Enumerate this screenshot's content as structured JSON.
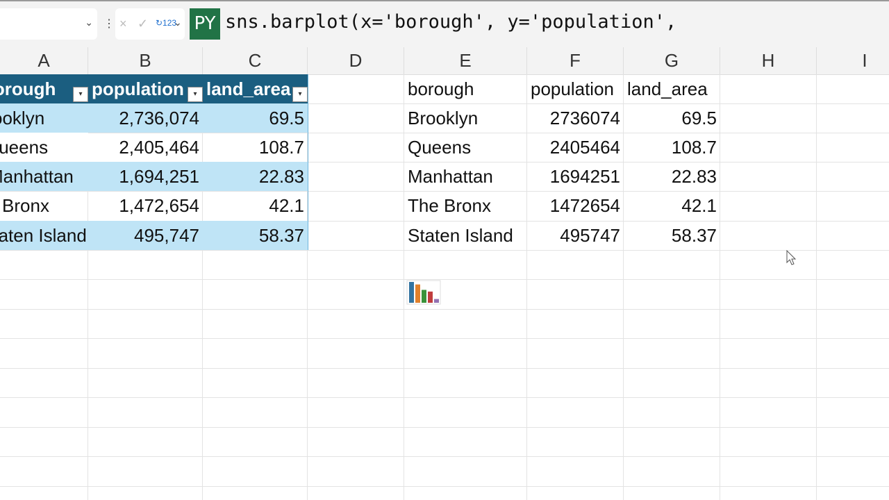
{
  "formula_bar": {
    "name_box": "",
    "formula": "sns.barplot(x='borough', y='population',",
    "py_badge": "PY",
    "cancel": "×",
    "enter": "✓",
    "return_type": "↻123"
  },
  "columns": [
    "A",
    "B",
    "C",
    "D",
    "E",
    "F",
    "G",
    "H",
    "I"
  ],
  "table": {
    "headers": [
      "borough",
      "population",
      "land_area"
    ],
    "rows": [
      [
        "Brooklyn",
        "2,736,074",
        "69.5"
      ],
      [
        "Queens",
        "2,405,464",
        "108.7"
      ],
      [
        "Manhattan",
        "1,694,251",
        "22.83"
      ],
      [
        "The Bronx",
        "1,472,654",
        "42.1"
      ],
      [
        "Staten Island",
        "495,747",
        "58.37"
      ]
    ]
  },
  "range": {
    "headers": [
      "borough",
      "population",
      "land_area"
    ],
    "rows": [
      [
        "Brooklyn",
        "2736074",
        "69.5"
      ],
      [
        "Queens",
        "2405464",
        "108.7"
      ],
      [
        "Manhattan",
        "1694251",
        "22.83"
      ],
      [
        "The Bronx",
        "1472654",
        "42.1"
      ],
      [
        "Staten Island",
        "495747",
        "58.37"
      ]
    ]
  },
  "thumbnail": {
    "values": [
      2736074,
      2405464,
      1694251,
      1472654,
      495747
    ],
    "colors": [
      "#3274a1",
      "#e1812c",
      "#3a923a",
      "#c03d3e",
      "#9372b2"
    ]
  }
}
